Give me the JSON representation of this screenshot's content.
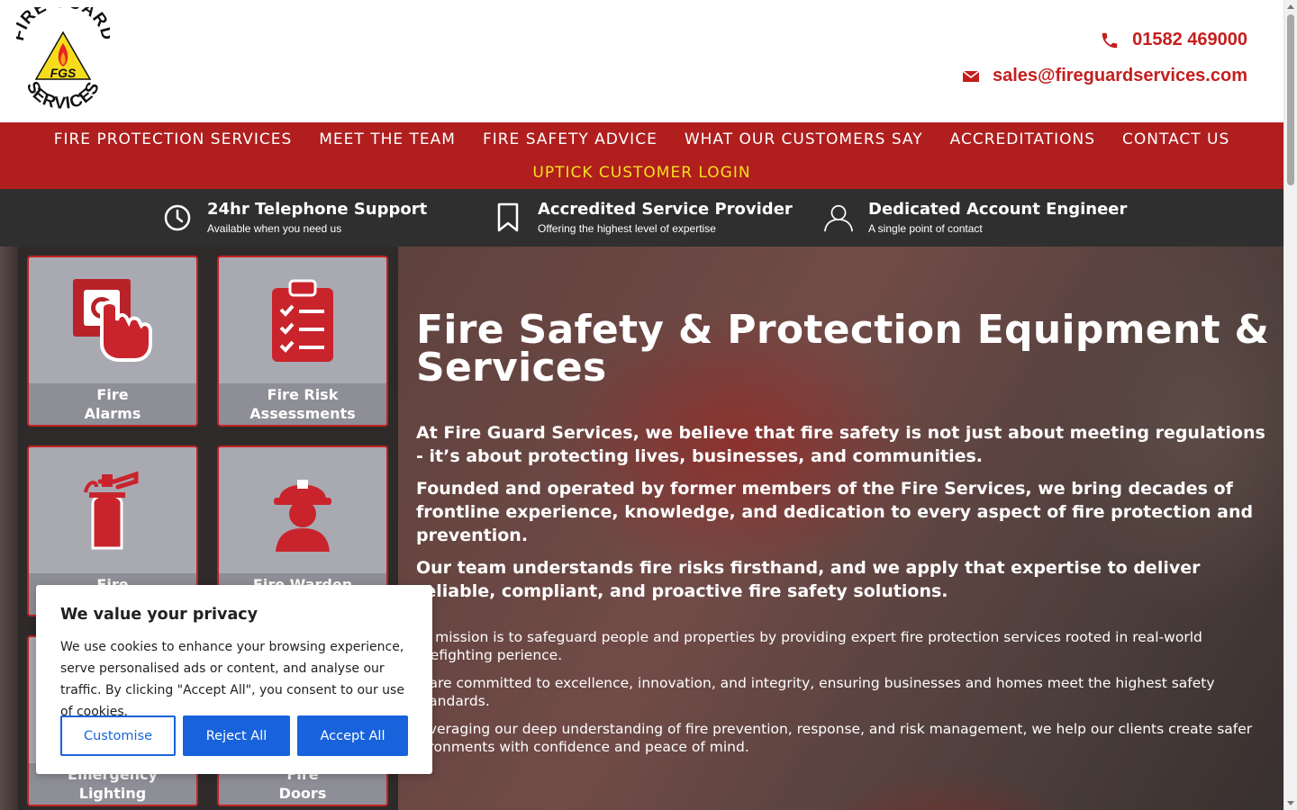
{
  "header": {
    "logo_text_top": "FIRE GUARD",
    "logo_text_center": "FGS",
    "logo_text_bottom": "SERVICES",
    "phone": "01582 469000",
    "email": "sales@fireguardservices.com"
  },
  "nav": {
    "items": [
      {
        "label": "FIRE PROTECTION SERVICES"
      },
      {
        "label": "MEET THE TEAM"
      },
      {
        "label": "FIRE SAFETY ADVICE"
      },
      {
        "label": "WHAT OUR CUSTOMERS SAY"
      },
      {
        "label": "ACCREDITATIONS"
      },
      {
        "label": "CONTACT US"
      }
    ],
    "login": "UPTICK CUSTOMER LOGIN"
  },
  "features": [
    {
      "title": "24hr Telephone Support",
      "subtitle": "Available when you need us",
      "icon": "clock-icon"
    },
    {
      "title": "Accredited Service Provider",
      "subtitle": "Offering the highest level of expertise",
      "icon": "bookmark-icon"
    },
    {
      "title": "Dedicated Account Engineer",
      "subtitle": "A single point of contact",
      "icon": "user-icon"
    }
  ],
  "tiles": [
    {
      "label": "Fire\nAlarms",
      "icon": "alarm-button-icon"
    },
    {
      "label": "Fire Risk\nAssessments",
      "icon": "clipboard-checklist-icon"
    },
    {
      "label": "Fire",
      "icon": "fire-extinguisher-icon"
    },
    {
      "label": "Fire Warden",
      "icon": "firefighter-icon"
    },
    {
      "label": "Emergency\nLighting",
      "icon": "emergency-light-icon"
    },
    {
      "label": "Fire\nDoors",
      "icon": "door-icon"
    }
  ],
  "hero": {
    "title": "Fire Safety & Protection Equipment & Services",
    "paragraphs_strong": [
      "At Fire Guard Services, we believe that fire safety is not just about meeting regulations - it’s about protecting lives, businesses, and communities.",
      "Founded and operated by former members of the Fire Services, we bring decades of frontline experience, knowledge, and dedication to every aspect of fire protection and prevention.",
      "Our team understands fire risks firsthand, and we apply that expertise to deliver reliable, compliant, and proactive fire safety solutions."
    ],
    "paragraphs": [
      "ur mission is to safeguard people and properties by providing expert fire protection services rooted in real-world firefighting perience.",
      "e are committed to excellence, innovation, and integrity, ensuring businesses and homes meet the highest safety standards.",
      "leveraging our deep understanding of fire prevention, response, and risk management, we help our clients create safer vironments with confidence and peace of mind."
    ]
  },
  "cookie": {
    "title": "We value your privacy",
    "text": "We use cookies to enhance your browsing experience, serve personalised ads or content, and analyse our traffic. By clicking \"Accept All\", you consent to our use of cookies.",
    "customise": "Customise",
    "reject": "Reject All",
    "accept": "Accept All"
  },
  "colors": {
    "brand_red": "#b01e1e",
    "link_red": "#c41e1e",
    "login_yellow": "#f5e11c",
    "dark_bar": "#2f2f2f",
    "cookie_blue": "#1863dc"
  }
}
